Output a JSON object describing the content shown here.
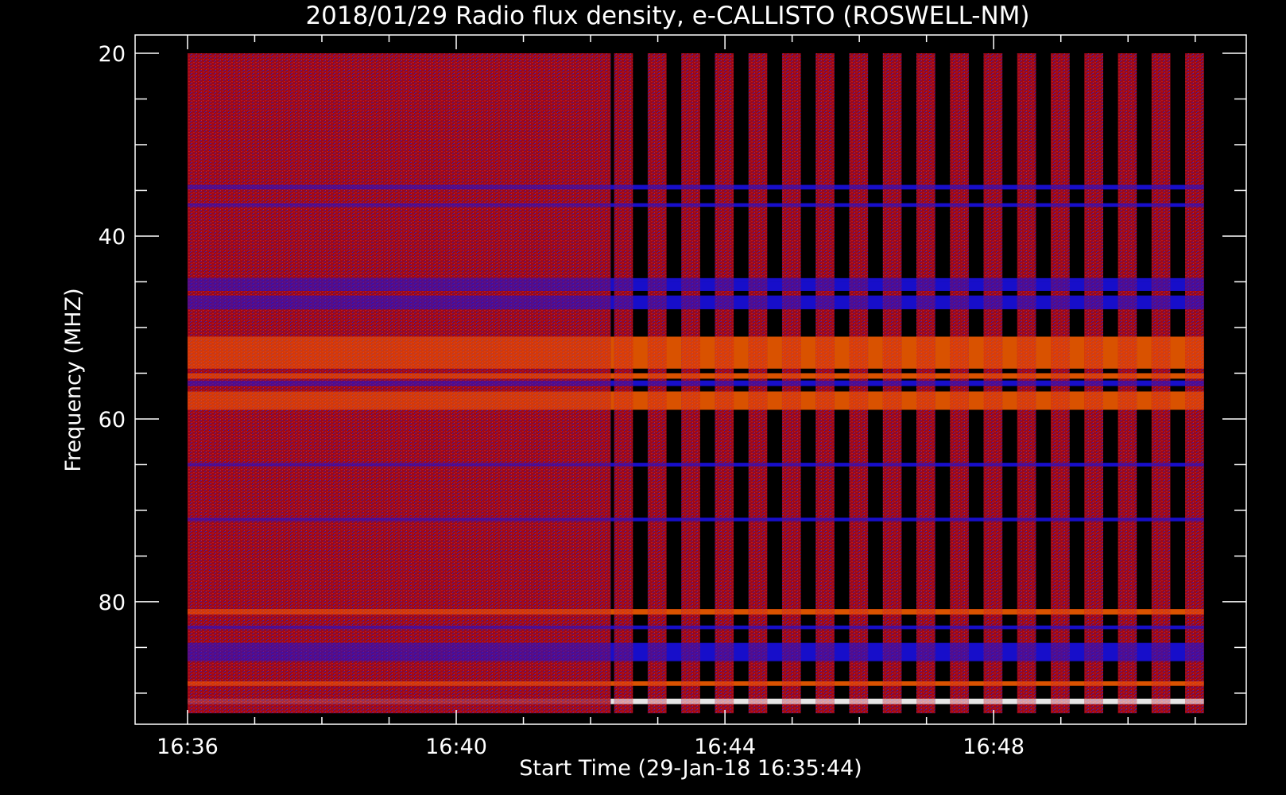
{
  "chart_data": {
    "type": "heatmap",
    "title": "2018/01/29  Radio flux density, e-CALLISTO (ROSWELL-NM)",
    "xlabel": "Start Time (29-Jan-18 16:35:44)",
    "ylabel": "Frequency (MHZ)",
    "xlim_minutes": [
      35.22,
      51.76
    ],
    "ylim_mhz": [
      93.4,
      18.0
    ],
    "x_ticks": [
      {
        "label": "16:36",
        "minute": 36
      },
      {
        "label": "16:40",
        "minute": 40
      },
      {
        "label": "16:44",
        "minute": 44
      },
      {
        "label": "16:48",
        "minute": 48
      }
    ],
    "x_minor_step_minutes": 1,
    "y_ticks": [
      {
        "label": "20",
        "mhz": 20
      },
      {
        "label": "40",
        "mhz": 40
      },
      {
        "label": "60",
        "mhz": 60
      },
      {
        "label": "80",
        "mhz": 80
      }
    ],
    "y_minor_step_mhz": 5,
    "data_extent": {
      "time_start": 36.0,
      "time_end": 51.0,
      "freq_top": 20,
      "freq_bottom": 92.2
    },
    "continuous_until": 42.3,
    "sweep_bars_start": [
      42.35,
      42.85,
      43.35,
      43.85,
      44.35,
      44.85,
      45.35,
      45.85,
      46.35,
      46.85,
      47.35,
      47.85,
      48.35,
      48.85,
      49.35,
      49.85,
      50.35,
      50.85
    ],
    "sweep_bar_width_minutes": 0.28,
    "bands": [
      {
        "fmin": 45.0,
        "fmax": 46.0,
        "level": "blue"
      },
      {
        "fmin": 46.5,
        "fmax": 48.0,
        "level": "blue"
      },
      {
        "fmin": 51.0,
        "fmax": 54.5,
        "level": "bright"
      },
      {
        "fmin": 55.0,
        "fmax": 55.6,
        "level": "bright"
      },
      {
        "fmin": 55.8,
        "fmax": 56.4,
        "level": "blue"
      },
      {
        "fmin": 57.0,
        "fmax": 59.0,
        "level": "bright"
      },
      {
        "fmin": 34.4,
        "fmax": 34.9,
        "level": "blue"
      },
      {
        "fmin": 36.4,
        "fmax": 36.8,
        "level": "blue"
      },
      {
        "fmin": 44.6,
        "fmax": 45.0,
        "level": "blue"
      },
      {
        "fmin": 64.8,
        "fmax": 65.2,
        "level": "blue"
      },
      {
        "fmin": 70.8,
        "fmax": 71.2,
        "level": "blue"
      },
      {
        "fmin": 80.8,
        "fmax": 81.4,
        "level": "bright"
      },
      {
        "fmin": 82.6,
        "fmax": 83.0,
        "level": "blue"
      },
      {
        "fmin": 84.5,
        "fmax": 86.5,
        "level": "blue"
      },
      {
        "fmin": 88.7,
        "fmax": 89.2,
        "level": "bright"
      },
      {
        "fmin": 90.6,
        "fmax": 91.2,
        "level": "white"
      }
    ],
    "colormap": [
      "#000000",
      "#1a10e0",
      "#8a0010",
      "#e01010",
      "#ff6000",
      "#ffff40",
      "#ffffff"
    ],
    "grid": false,
    "legend": "none"
  }
}
